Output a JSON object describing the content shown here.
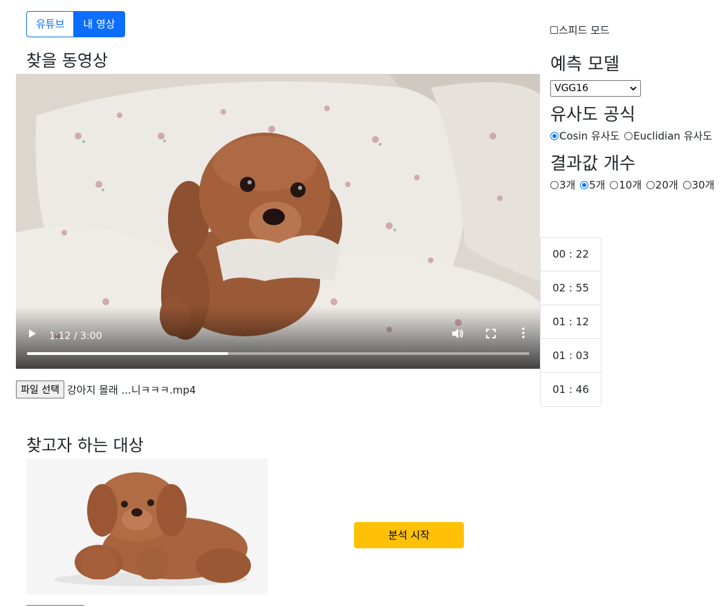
{
  "source_toggle": {
    "youtube_label": "유튜브",
    "my_video_label": "내 영상"
  },
  "video_section": {
    "title": "찾을 동영상"
  },
  "player": {
    "current_time": "1:12",
    "duration": "3:00",
    "time_display": "1:12 / 3:00",
    "progress_fraction": 0.4
  },
  "file_input": {
    "button_label": "파일 선택",
    "file_name": "강아지 몰래 ...니ㅋㅋㅋ.mp4"
  },
  "timestamps": [
    "00 : 22",
    "02 : 55",
    "01 : 12",
    "01 : 03",
    "01 : 46"
  ],
  "settings": {
    "speed_mode_label": "스피드 모드",
    "speed_mode_checked": false,
    "model_title": "예측 모델",
    "model_selected": "VGG16",
    "similarity_title": "유사도 공식",
    "similarity_options": [
      "Cosin 유사도",
      "Euclidian 유사도"
    ],
    "similarity_selected": 0,
    "result_count_title": "결과값 개수",
    "result_count_options": [
      "3개",
      "5개",
      "10개",
      "20개",
      "30개"
    ],
    "result_count_selected": 1
  },
  "target_section": {
    "title": "찾고자 하는 대상"
  },
  "actions": {
    "start_label": "분석 시작"
  },
  "colors": {
    "primary": "#0d6efd",
    "warning": "#ffc107",
    "radio_checked": "#0075ff"
  }
}
